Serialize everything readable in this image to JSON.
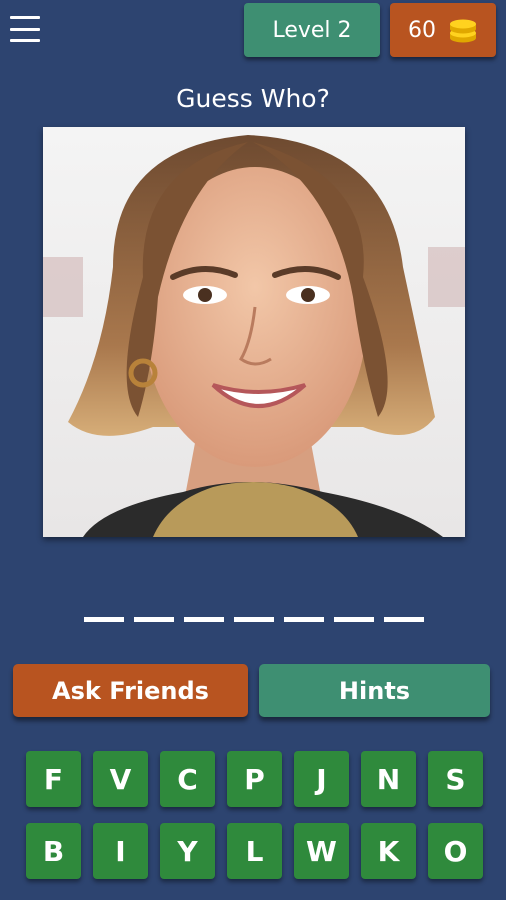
{
  "header": {
    "level_label": "Level 2",
    "coins": "60"
  },
  "title": "Guess Who?",
  "answer": {
    "letter_count": 7
  },
  "buttons": {
    "ask_friends": "Ask Friends",
    "hints": "Hints"
  },
  "keyboard": {
    "keys": [
      "F",
      "V",
      "C",
      "P",
      "J",
      "N",
      "S",
      "B",
      "I",
      "Y",
      "L",
      "W",
      "K",
      "O"
    ]
  },
  "colors": {
    "background": "#2d4470",
    "level_green": "#3e8f72",
    "coins_orange": "#b85420",
    "key_green": "#2f8a3c"
  }
}
